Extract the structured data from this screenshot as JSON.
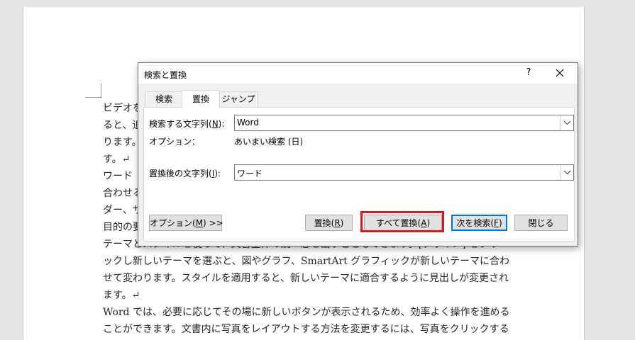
{
  "document": {
    "lines": [
      "ビデオを",
      "ると、追",
      "ります。",
      "す。↵",
      "ワード",
      "合わせる",
      "ダー、サ",
      "目的の要",
      "テーマとスタイルを使って、文書全体の統一感を出すこともできます。[デザイン] をクリ",
      "ックし新しいテーマを選ぶと、図やグラフ、SmartArt グラフィックが新しいテーマに合わ",
      "せて変わります。スタイルを適用すると、新しいテーマに適合するように見出しが変更され",
      "ます。↵",
      "Word では、必要に応じてその場に新しいボタンが表示されるため、効率よく操作を進める",
      "ことができます。文書内に写真をレイアウトする方法を変更するには、写真をクリックする"
    ]
  },
  "dialog": {
    "title": "検索と置換",
    "help": "?",
    "tabs": [
      "検索",
      "置換",
      "ジャンプ"
    ],
    "find": {
      "label_pre": "検索する文字列(",
      "key": "N",
      "label_post": "):",
      "value": "Word"
    },
    "options": {
      "label": "オプション：",
      "value": "あいまい検索 (日)"
    },
    "replace": {
      "label_pre": "置換後の文字列(",
      "key": "I",
      "label_post": "):",
      "value": "ワード"
    },
    "buttons": {
      "options": {
        "pre": "オプション(",
        "key": "M",
        "post": ") >>"
      },
      "replace": {
        "pre": "置換(",
        "key": "R",
        "post": ")"
      },
      "replace_all": {
        "pre": "すべて置換(",
        "key": "A",
        "post": ")"
      },
      "find_next": {
        "pre": "次を検索(",
        "key": "F",
        "post": ")"
      },
      "close": "閉じる"
    }
  },
  "colors": {
    "highlight": "#e0141e",
    "default_button": "#0078d7"
  }
}
